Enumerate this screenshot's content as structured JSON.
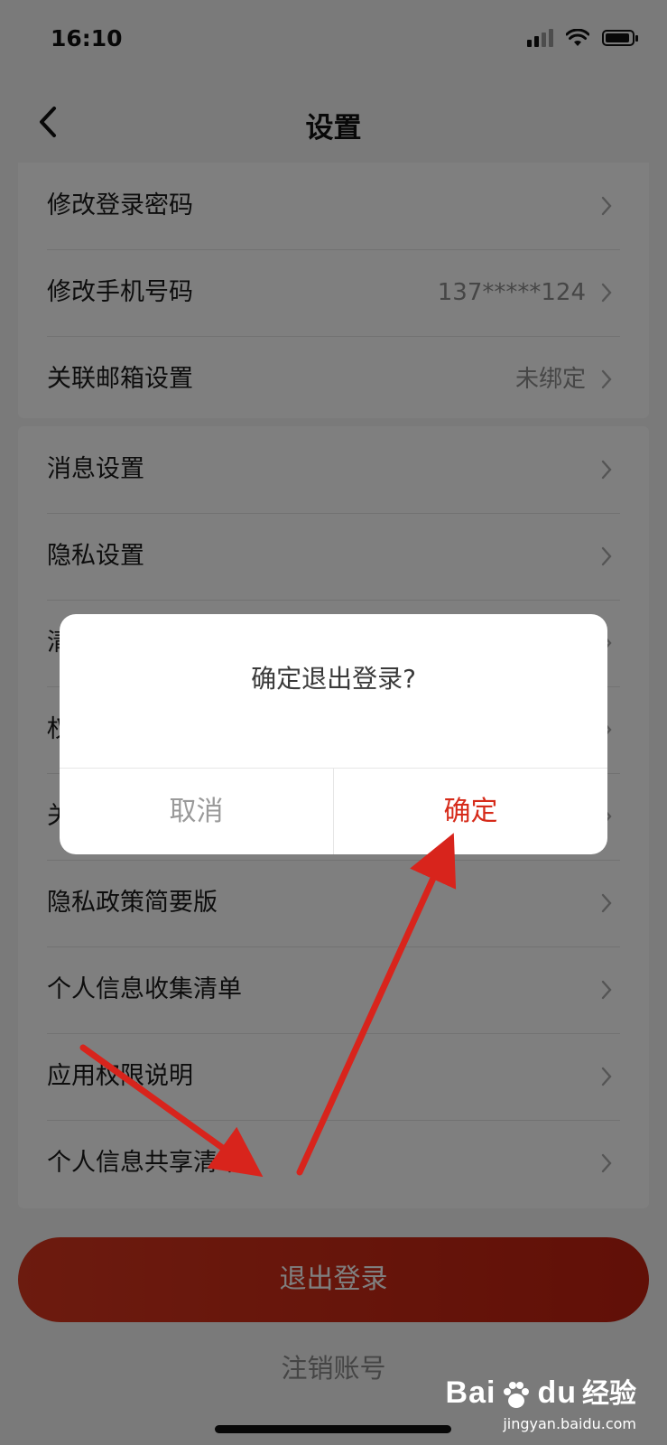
{
  "status_bar": {
    "time": "16:10"
  },
  "nav": {
    "title": "设置"
  },
  "group1": [
    {
      "label": "修改登录密码",
      "value": ""
    },
    {
      "label": "修改手机号码",
      "value": "137*****124"
    },
    {
      "label": "关联邮箱设置",
      "value": "未绑定"
    }
  ],
  "group2": [
    {
      "label": "消息设置"
    },
    {
      "label": "隐私设置"
    },
    {
      "label": "清"
    },
    {
      "label": "权"
    },
    {
      "label": "关"
    },
    {
      "label": "隐私政策简要版"
    },
    {
      "label": "个人信息收集清单"
    },
    {
      "label": "应用权限说明"
    },
    {
      "label": "个人信息共享清单"
    }
  ],
  "buttons": {
    "logout": "退出登录",
    "cancel_account": "注销账号"
  },
  "dialog": {
    "message": "确定退出登录?",
    "cancel": "取消",
    "confirm": "确定"
  },
  "watermark": {
    "brand": "Bai",
    "brand2": "du",
    "cn": "经验",
    "url": "jingyan.baidu.com"
  },
  "colors": {
    "accent": "#d62b1a",
    "annotation_arrow": "#d8241c"
  }
}
